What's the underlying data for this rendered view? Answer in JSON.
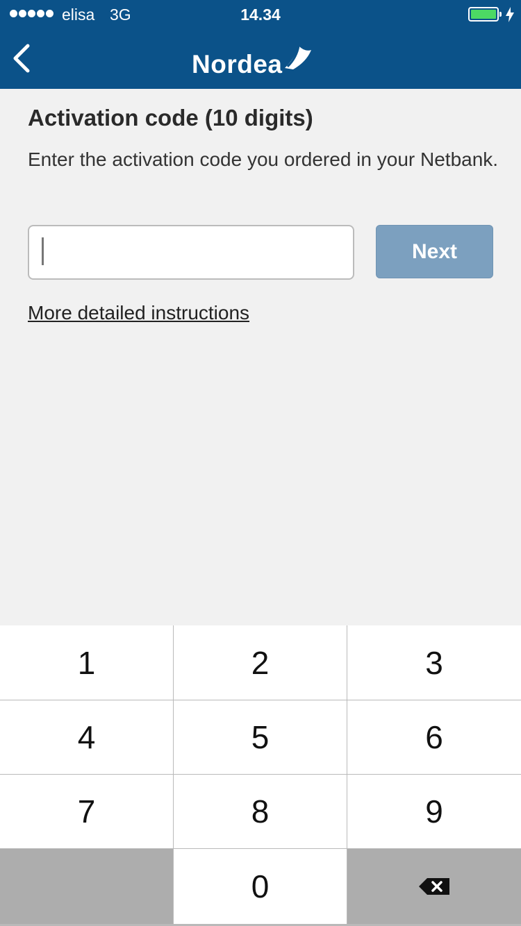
{
  "status_bar": {
    "carrier": "elisa",
    "network": "3G",
    "time": "14.34",
    "battery_level": 1.0
  },
  "header": {
    "back_icon": "chevron-left-icon",
    "logo_text": "Nordea",
    "logo_icon": "nordea-sail-icon"
  },
  "content": {
    "title": "Activation code (10 digits)",
    "description": "Enter the activation code you ordered in your Netbank.",
    "input_value": "",
    "next_label": "Next",
    "instructions_link": "More detailed instructions"
  },
  "keypad": {
    "rows": [
      [
        "1",
        "2",
        "3"
      ],
      [
        "4",
        "5",
        "6"
      ],
      [
        "7",
        "8",
        "9"
      ],
      [
        "",
        "0",
        "delete"
      ]
    ],
    "delete_icon": "backspace-icon"
  },
  "colors": {
    "header": "#0b5289",
    "background": "#f1f1f1",
    "next_button": "#7ca0bf",
    "battery": "#4cd964"
  }
}
